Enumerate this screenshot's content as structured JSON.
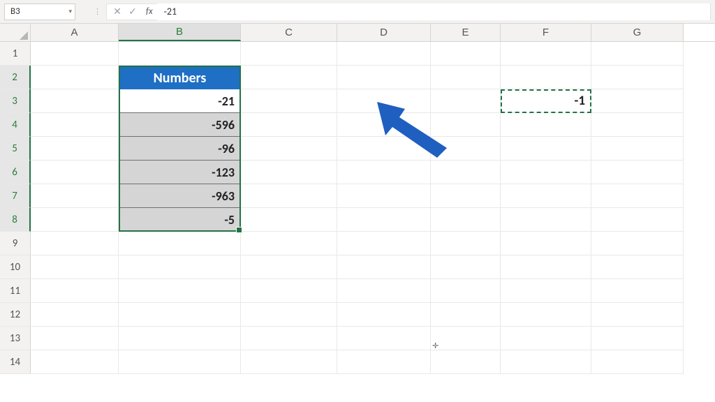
{
  "formulaBar": {
    "cellRef": "B3",
    "cancelGlyph": "✕",
    "enterGlyph": "✓",
    "fxLabel": "fx",
    "value": "-21"
  },
  "columns": [
    "A",
    "B",
    "C",
    "D",
    "E",
    "F",
    "G"
  ],
  "rowNumbers": [
    "1",
    "2",
    "3",
    "4",
    "5",
    "6",
    "7",
    "8",
    "9",
    "10",
    "11",
    "12",
    "13",
    "14"
  ],
  "selectedColumn": "B",
  "selectedRows": [
    "2",
    "3",
    "4",
    "5",
    "6",
    "7",
    "8"
  ],
  "table": {
    "header": "Numbers",
    "values": [
      "-21",
      "-596",
      "-96",
      "-123",
      "-963",
      "-5"
    ]
  },
  "copiedCell": {
    "ref": "F3",
    "value": "-1"
  },
  "cursorGlyph": "✛"
}
